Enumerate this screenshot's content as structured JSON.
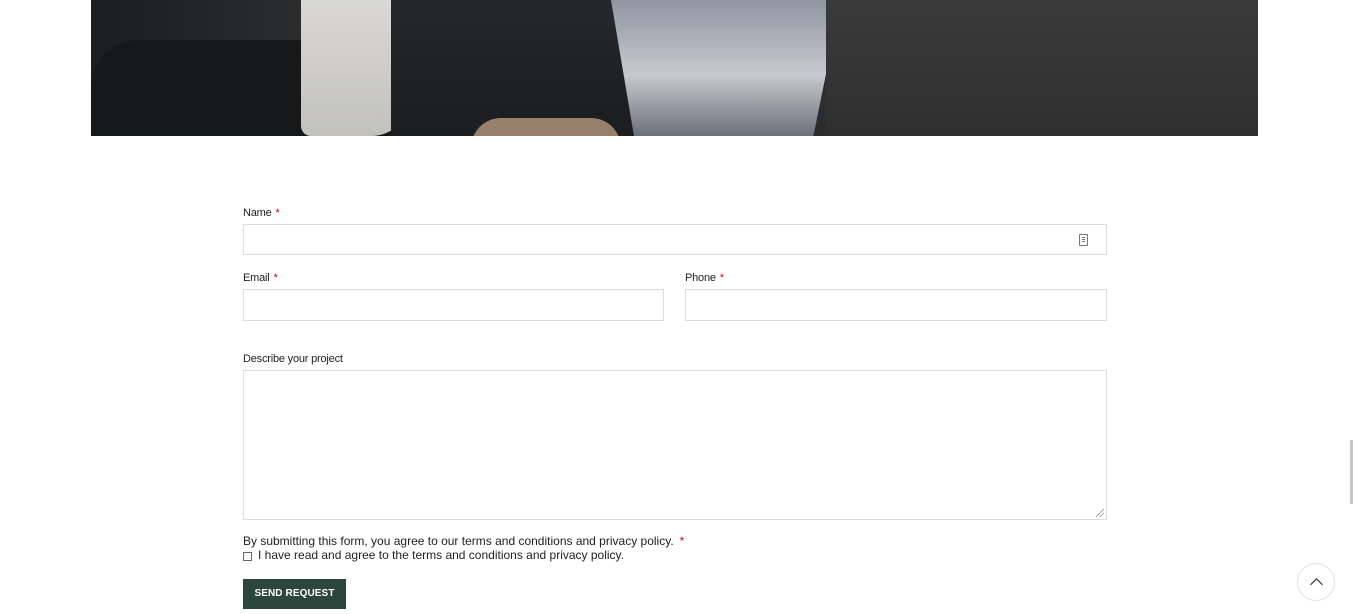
{
  "form": {
    "name_label": "Name",
    "email_label": "Email",
    "phone_label": "Phone",
    "describe_label": "Describe your project",
    "required_mark": "*",
    "name_value": "",
    "email_value": "",
    "phone_value": "",
    "describe_value": "",
    "consent_text": "By submitting this form, you agree to our terms and conditions and privacy policy.",
    "checkbox_label": "I have read and agree to the terms and conditions and privacy policy.",
    "checkbox_checked": false,
    "submit_label": "SEND REQUEST"
  },
  "colors": {
    "button_bg": "#2d463d",
    "required": "#d0021b"
  },
  "icons": {
    "name_field_icon": "contact-card-icon",
    "scroll_top_icon": "chevron-up-icon"
  }
}
